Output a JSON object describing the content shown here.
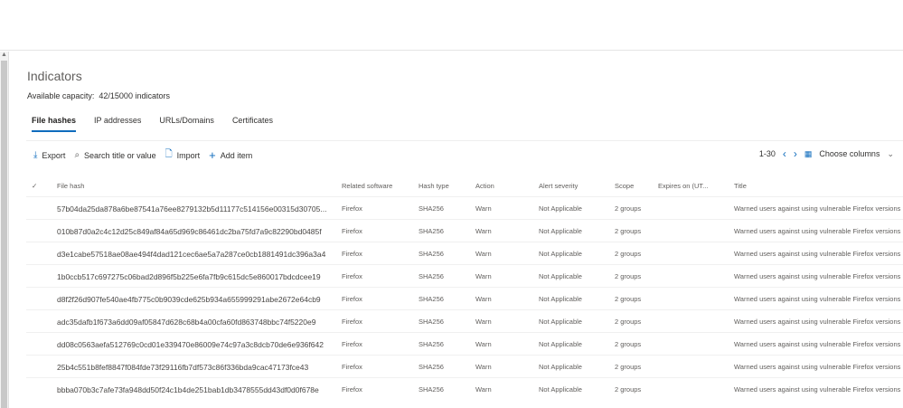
{
  "page": {
    "title": "Indicators",
    "capacity_label": "Available capacity:",
    "capacity_value": "42/15000 indicators"
  },
  "tabs": [
    {
      "label": "File hashes",
      "active": true
    },
    {
      "label": "IP addresses"
    },
    {
      "label": "URLs/Domains"
    },
    {
      "label": "Certificates"
    }
  ],
  "toolbar": {
    "export": "Export",
    "search": "Search title or value",
    "import": "Import",
    "add": "Add item",
    "pagination": "1-30",
    "choose_columns": "Choose columns"
  },
  "columns": [
    "File hash",
    "Related software",
    "Hash type",
    "Action",
    "Alert severity",
    "Scope",
    "Expires on (UT...",
    "Title"
  ],
  "rows": [
    {
      "hash": "57b04da25da878a6be87541a76ee8279132b5d11177c514156e00315d30705...",
      "software": "Firefox",
      "type": "SHA256",
      "action": "Warn",
      "severity": "Not Applicable",
      "scope": "2 groups",
      "expires": "",
      "title": "Warned users against using vulnerable Firefox versions"
    },
    {
      "hash": "010b87d0a2c4c12d25c849af84a65d969c86461dc2ba75fd7a9c82290bd0485f",
      "software": "Firefox",
      "type": "SHA256",
      "action": "Warn",
      "severity": "Not Applicable",
      "scope": "2 groups",
      "expires": "",
      "title": "Warned users against using vulnerable Firefox versions"
    },
    {
      "hash": "d3e1cabe57518ae08ae494f4dad121cec6ae5a7a287ce0cb1881491dc396a3a4",
      "software": "Firefox",
      "type": "SHA256",
      "action": "Warn",
      "severity": "Not Applicable",
      "scope": "2 groups",
      "expires": "",
      "title": "Warned users against using vulnerable Firefox versions"
    },
    {
      "hash": "1b0ccb517c697275c06bad2d896f5b225e6fa7fb9c615dc5e860017bdcdcee19",
      "software": "Firefox",
      "type": "SHA256",
      "action": "Warn",
      "severity": "Not Applicable",
      "scope": "2 groups",
      "expires": "",
      "title": "Warned users against using vulnerable Firefox versions"
    },
    {
      "hash": "d8f2f26d907fe540ae4fb775c0b9039cde625b934a655999291abe2672e64cb9",
      "software": "Firefox",
      "type": "SHA256",
      "action": "Warn",
      "severity": "Not Applicable",
      "scope": "2 groups",
      "expires": "",
      "title": "Warned users against using vulnerable Firefox versions"
    },
    {
      "hash": "adc35dafb1f673a6dd09af05847d628c68b4a00cfa60fd863748bbc74f5220e9",
      "software": "Firefox",
      "type": "SHA256",
      "action": "Warn",
      "severity": "Not Applicable",
      "scope": "2 groups",
      "expires": "",
      "title": "Warned users against using vulnerable Firefox versions"
    },
    {
      "hash": "dd08c0563aefa512769c0cd01e339470e86009e74c97a3c8dcb70de6e936f642",
      "software": "Firefox",
      "type": "SHA256",
      "action": "Warn",
      "severity": "Not Applicable",
      "scope": "2 groups",
      "expires": "",
      "title": "Warned users against using vulnerable Firefox versions"
    },
    {
      "hash": "25b4c551b8fef8847f084fde73f29116fb7df573c86f336bda9cac47173fce43",
      "software": "Firefox",
      "type": "SHA256",
      "action": "Warn",
      "severity": "Not Applicable",
      "scope": "2 groups",
      "expires": "",
      "title": "Warned users against using vulnerable Firefox versions"
    },
    {
      "hash": "bbba070b3c7afe73fa948dd50f24c1b4de251bab1db3478555dd43df0d0f678e",
      "software": "Firefox",
      "type": "SHA256",
      "action": "Warn",
      "severity": "Not Applicable",
      "scope": "2 groups",
      "expires": "",
      "title": "Warned users against using vulnerable Firefox versions"
    }
  ]
}
